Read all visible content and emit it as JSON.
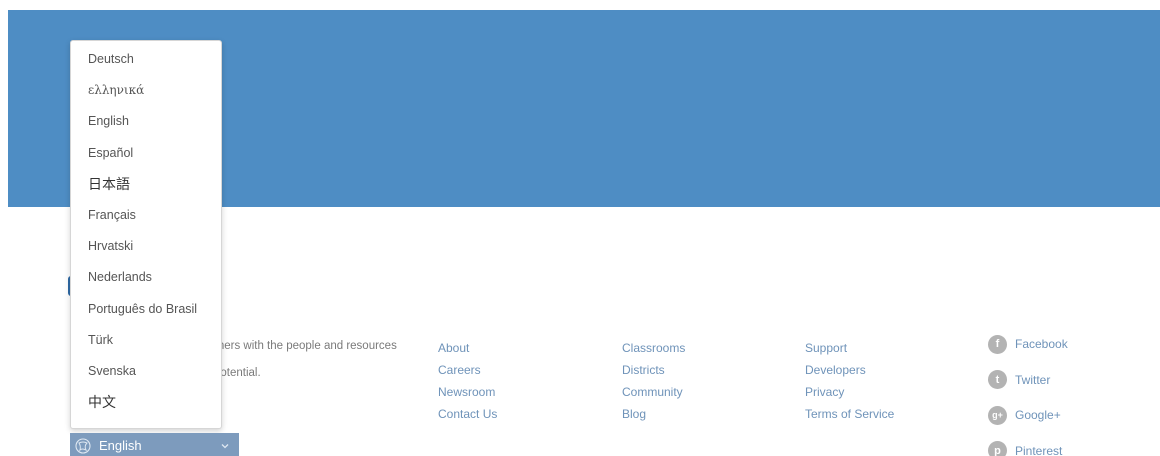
{
  "language_menu": {
    "items": [
      {
        "label": "Deutsch"
      },
      {
        "label": "ελληνικά"
      },
      {
        "label": "English"
      },
      {
        "label": "Español"
      },
      {
        "label": "日本語"
      },
      {
        "label": "Français"
      },
      {
        "label": "Hrvatski"
      },
      {
        "label": "Nederlands"
      },
      {
        "label": "Português do Brasil"
      },
      {
        "label": "Türk"
      },
      {
        "label": "Svenska"
      },
      {
        "label": "中文"
      }
    ]
  },
  "footer": {
    "mission_partial": {
      "line1": "rners with the people and resources",
      "line2": "potential."
    },
    "links": {
      "col1": [
        "About",
        "Careers",
        "Newsroom",
        "Contact Us"
      ],
      "col2": [
        "Classrooms",
        "Districts",
        "Community",
        "Blog"
      ],
      "col3": [
        "Support",
        "Developers",
        "Privacy",
        "Terms of Service"
      ]
    },
    "social": [
      {
        "label": "Facebook",
        "icon": "facebook-icon"
      },
      {
        "label": "Twitter",
        "icon": "twitter-icon"
      },
      {
        "label": "Google+",
        "icon": "google-plus-icon"
      },
      {
        "label": "Pinterest",
        "icon": "pinterest-icon"
      }
    ]
  },
  "language_selector": {
    "selected": "English",
    "icon": "globe-icon"
  },
  "colors": {
    "hero": "#4e8dc4",
    "link": "#6f93b9",
    "selector": "#7d9bbd"
  }
}
